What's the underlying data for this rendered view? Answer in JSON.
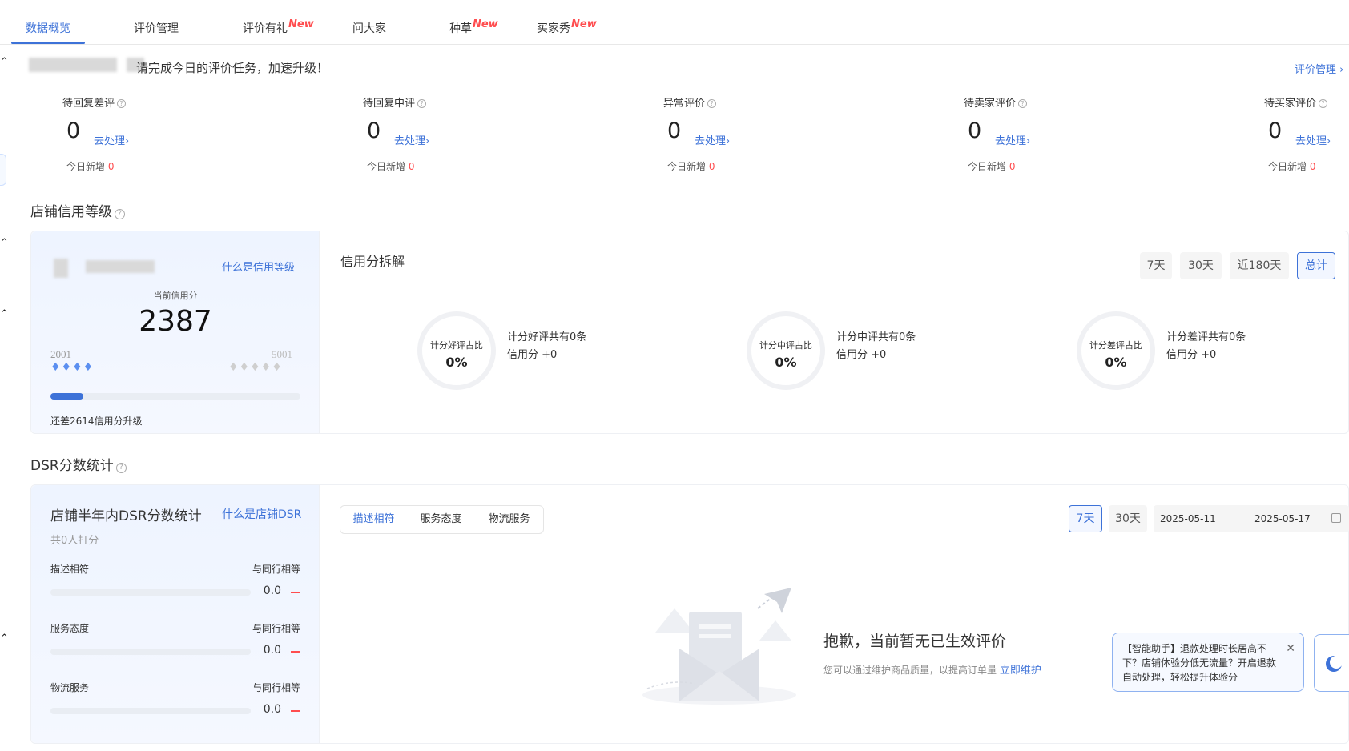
{
  "tabs": [
    {
      "label": "数据概览",
      "new": "",
      "active": true
    },
    {
      "label": "评价管理",
      "new": ""
    },
    {
      "label": "评价有礼",
      "new": "New"
    },
    {
      "label": "问大家",
      "new": ""
    },
    {
      "label": "种草",
      "new": "New"
    },
    {
      "label": "买家秀",
      "new": "New"
    }
  ],
  "banner": {
    "text": "请完成今日的评价任务，加速升级！",
    "manage_link": "评价管理 ›"
  },
  "tasks": [
    {
      "title": "待回复差评",
      "count": "0",
      "action": "去处理›",
      "today_label": "今日新增",
      "today": "0"
    },
    {
      "title": "待回复中评",
      "count": "0",
      "action": "去处理›",
      "today_label": "今日新增",
      "today": "0"
    },
    {
      "title": "异常评价",
      "count": "0",
      "action": "去处理›",
      "today_label": "今日新增",
      "today": "0"
    },
    {
      "title": "待卖家评价",
      "count": "0",
      "action": "去处理›",
      "today_label": "今日新增",
      "today": "0"
    },
    {
      "title": "待买家评价",
      "count": "0",
      "action": "去处理›",
      "today_label": "今日新增",
      "today": "0"
    }
  ],
  "credit": {
    "section_title": "店铺信用等级",
    "what_link": "什么是信用等级",
    "score_label": "当前信用分",
    "score": "2387",
    "range_min": "2001",
    "range_max": "5001",
    "progress": 0.13,
    "upgrade_text": "还差2614信用分升级",
    "breakdown_title": "信用分拆解",
    "ranges": [
      "7天",
      "30天",
      "近180天",
      "总计"
    ],
    "active_range": 3,
    "rings": [
      {
        "label": "计分好评占比",
        "value": "0%",
        "line1": "计分好评共有0条",
        "line2": "信用分 +0"
      },
      {
        "label": "计分中评占比",
        "value": "0%",
        "line1": "计分中评共有0条",
        "line2": "信用分 +0"
      },
      {
        "label": "计分差评占比",
        "value": "0%",
        "line1": "计分差评共有0条",
        "line2": "信用分 +0"
      }
    ]
  },
  "dsr": {
    "section_title": "DSR分数统计",
    "card_title": "店铺半年内DSR分数统计",
    "what_link": "什么是店铺DSR",
    "raters": "共0人打分",
    "items": [
      {
        "name": "描述相符",
        "compare": "与同行相等",
        "score": "0.0"
      },
      {
        "name": "服务态度",
        "compare": "与同行相等",
        "score": "0.0"
      },
      {
        "name": "物流服务",
        "compare": "与同行相等",
        "score": "0.0"
      }
    ],
    "tabs": [
      "描述相符",
      "服务态度",
      "物流服务"
    ],
    "active_tab": 0,
    "ranges": [
      "7天",
      "30天"
    ],
    "active_range": 0,
    "date_start": "2025-05-11",
    "date_end": "2025-05-17",
    "empty_title": "抱歉，当前暂无已生效评价",
    "empty_desc": "您可以通过维护商品质量，以提高订单量",
    "empty_link": "立即维护"
  },
  "assistant_tip": "【智能助手】退款处理时长居高不下？店铺体验分低无流量？开启退款自动处理，轻松提升体验分",
  "colors": {
    "accent": "#3d72d8",
    "danger": "#ff4d4f"
  }
}
